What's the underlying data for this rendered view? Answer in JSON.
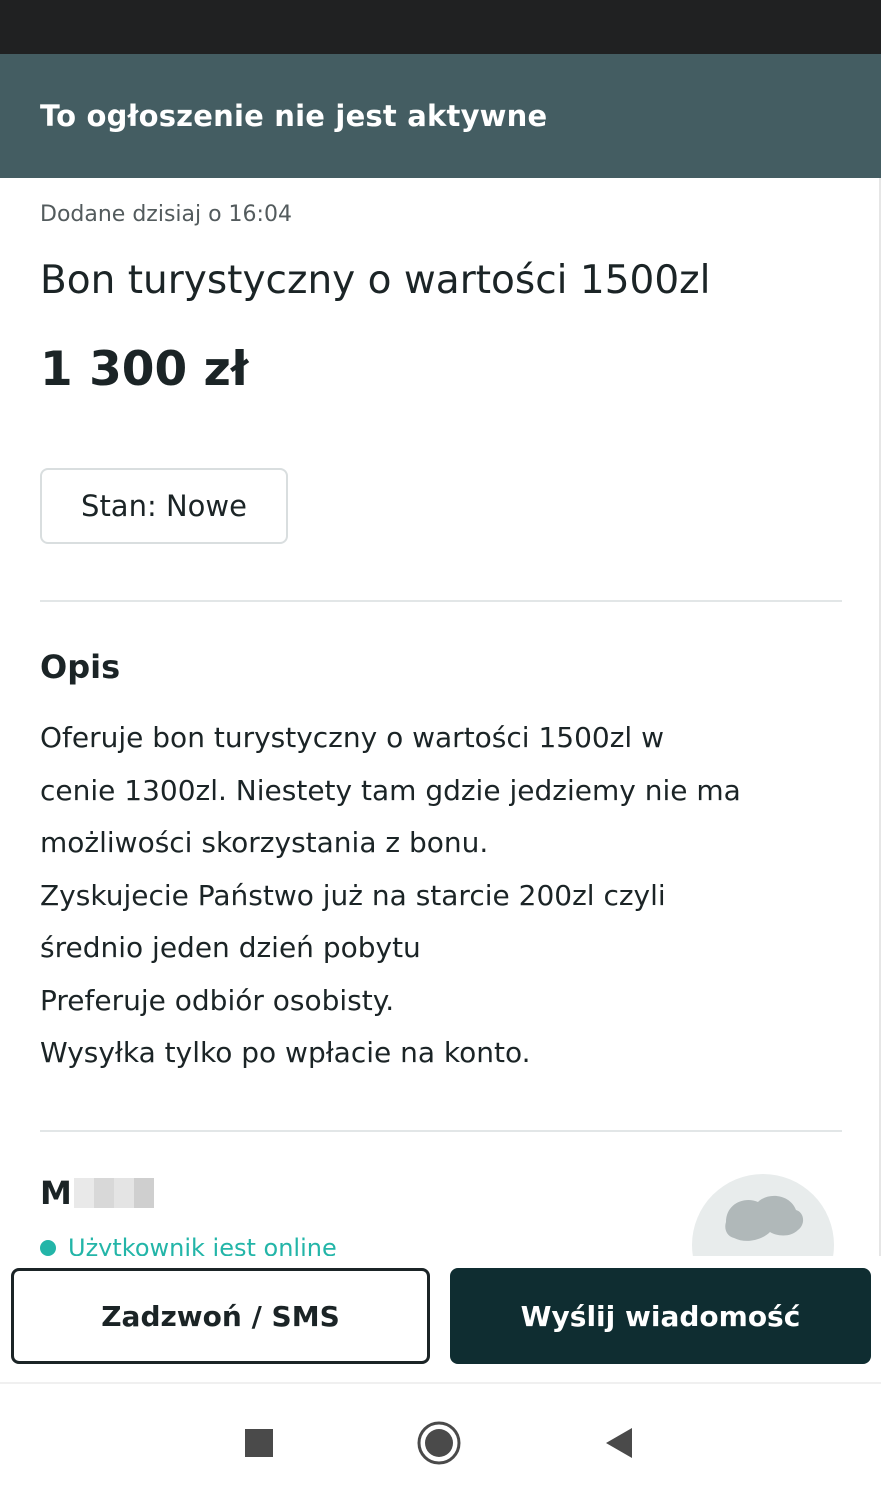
{
  "banner": {
    "text": "To ogłoszenie nie jest aktywne"
  },
  "listing": {
    "added": "Dodane dzisiaj o 16:04",
    "title": "Bon turystyczny o wartości 1500zl",
    "price": "1 300 zł",
    "condition": "Stan: Nowe"
  },
  "description": {
    "heading": "Opis",
    "lines": [
      "Oferuje bon turystyczny o wartości 1500zl w",
      "cenie 1300zl. Niestety tam gdzie jedziemy nie ma",
      "możliwości skorzystania z bonu.",
      "Zyskujecie Państwo już na starcie 200zl czyli",
      "średnio jeden dzień pobytu",
      "Preferuje odbiór osobisty.",
      "Wysyłka tylko po wpłacie na konto."
    ]
  },
  "seller": {
    "name_initial": "M",
    "status": "Użytkownik jest online"
  },
  "actions": {
    "call_label": "Zadzwoń / SMS",
    "message_label": "Wyślij wiadomość"
  },
  "colors": {
    "banner": "#445d62",
    "primary_button": "#0f2d31",
    "online": "#23b5a8"
  },
  "icons": {
    "nav_recent": "square-icon",
    "nav_home": "circle-home-icon",
    "nav_back": "triangle-back-icon",
    "avatar": "user-avatar-icon"
  }
}
